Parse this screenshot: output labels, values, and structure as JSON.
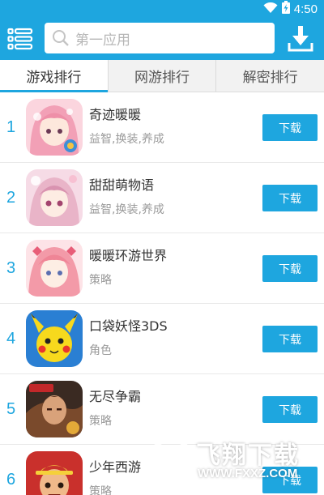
{
  "status_bar": {
    "time": "4:50",
    "wifi_icon": "wifi-icon",
    "battery_icon": "battery-charging-icon"
  },
  "app_bar": {
    "menu_icon": "menu-list-icon",
    "search_icon": "search-icon",
    "search_placeholder": "第一应用",
    "download_icon": "download-icon"
  },
  "tabs": [
    {
      "label": "游戏排行",
      "active": true
    },
    {
      "label": "网游排行",
      "active": false
    },
    {
      "label": "解密排行",
      "active": false
    }
  ],
  "games": [
    {
      "rank": "1",
      "name": "奇迹暖暖",
      "tags": "益智,换装,养成",
      "button": "下载"
    },
    {
      "rank": "2",
      "name": "甜甜萌物语",
      "tags": "益智,换装,养成",
      "button": "下载"
    },
    {
      "rank": "3",
      "name": "暖暖环游世界",
      "tags": "策略",
      "button": "下载"
    },
    {
      "rank": "4",
      "name": "口袋妖怪3DS",
      "tags": "角色",
      "button": "下载"
    },
    {
      "rank": "5",
      "name": "无尽争霸",
      "tags": "策略",
      "button": "下载"
    },
    {
      "rank": "6",
      "name": "少年西游",
      "tags": "策略",
      "button": "下载"
    }
  ],
  "watermark": {
    "title": "飞翔下载",
    "url": "WWW.FXXZ.COM"
  },
  "colors": {
    "accent": "#1ea6df",
    "tab_bg": "#f2f2f2",
    "tag_text": "#9a9a9a"
  }
}
